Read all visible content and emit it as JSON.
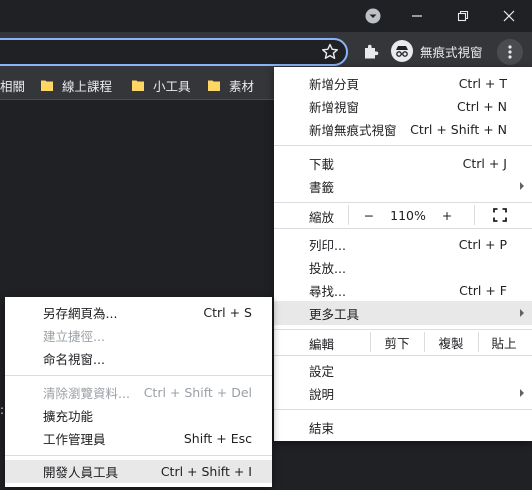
{
  "toolbar": {
    "incognito_label": "無痕式視窗"
  },
  "bookmarks": [
    {
      "label": "相關"
    },
    {
      "label": "線上課程"
    },
    {
      "label": "小工具"
    },
    {
      "label": "素材"
    }
  ],
  "main_menu": {
    "new_tab": {
      "label": "新增分頁",
      "shortcut": "Ctrl + T"
    },
    "new_window": {
      "label": "新增視窗",
      "shortcut": "Ctrl + N"
    },
    "new_incognito": {
      "label": "新增無痕式視窗",
      "shortcut": "Ctrl + Shift + N"
    },
    "downloads": {
      "label": "下載",
      "shortcut": "Ctrl + J"
    },
    "bookmarks": {
      "label": "書籤"
    },
    "zoom": {
      "label": "縮放",
      "minus": "−",
      "level": "110%",
      "plus": "+"
    },
    "print": {
      "label": "列印...",
      "shortcut": "Ctrl + P"
    },
    "cast": {
      "label": "投放..."
    },
    "find": {
      "label": "尋找...",
      "shortcut": "Ctrl + F"
    },
    "more_tools": {
      "label": "更多工具"
    },
    "edit": {
      "label": "編輯",
      "cut": "剪下",
      "copy": "複製",
      "paste": "貼上"
    },
    "settings": {
      "label": "設定"
    },
    "help": {
      "label": "說明"
    },
    "exit": {
      "label": "結束"
    }
  },
  "submenu": {
    "save_as": {
      "label": "另存網頁為...",
      "shortcut": "Ctrl + S"
    },
    "create_shortcut": {
      "label": "建立捷徑..."
    },
    "name_window": {
      "label": "命名視窗..."
    },
    "clear_data": {
      "label": "清除瀏覽資料...",
      "shortcut": "Ctrl + Shift + Del"
    },
    "extensions": {
      "label": "擴充功能"
    },
    "task_manager": {
      "label": "工作管理員",
      "shortcut": "Shift + Esc"
    },
    "dev_tools": {
      "label": "開發人員工具",
      "shortcut": "Ctrl + Shift + I"
    }
  },
  "colors": {
    "accent": "#8ab4f8",
    "folder": "#fdd663",
    "highlight": "#e8e8e8",
    "disabled": "#9aa0a6"
  }
}
